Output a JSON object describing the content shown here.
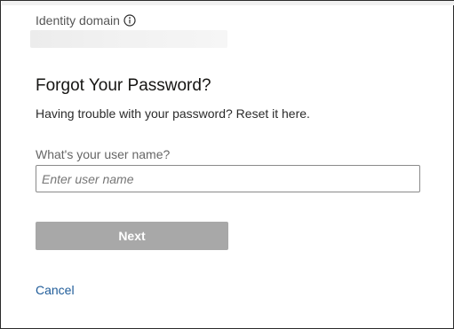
{
  "identity_domain": {
    "label": "Identity domain",
    "info_icon": "info-circle-icon"
  },
  "title": "Forgot Your Password?",
  "subtitle": "Having trouble with your password? Reset it here.",
  "username_field": {
    "label": "What's your user name?",
    "placeholder": "Enter user name",
    "value": ""
  },
  "next_button": {
    "label": "Next",
    "state": "disabled"
  },
  "cancel_link": {
    "label": "Cancel"
  },
  "colors": {
    "link": "#1f5c99",
    "button_disabled_bg": "#a8a8a8",
    "button_text": "#ffffff",
    "text_primary": "#161513",
    "text_secondary": "#666666"
  }
}
